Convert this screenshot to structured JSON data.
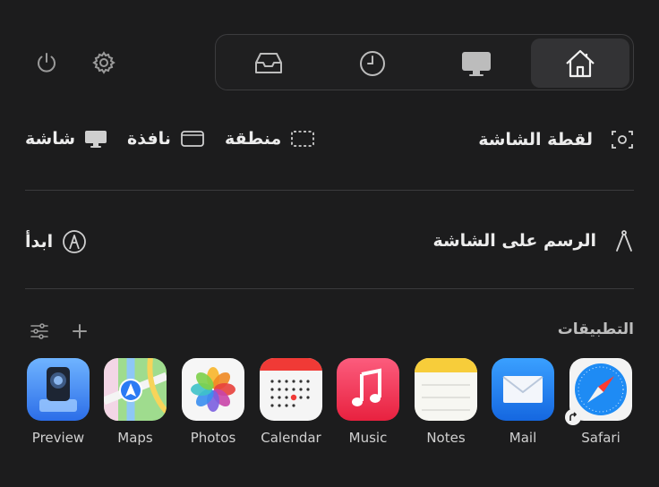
{
  "colors": {
    "background": "#1c1c1d",
    "active_segment": "#333335",
    "divider": "#3a3a3c"
  },
  "top_bar": {
    "left_icons": [
      "power-icon",
      "gear-icon"
    ],
    "segments": [
      {
        "icon": "tray-icon",
        "active": false
      },
      {
        "icon": "clock-icon",
        "active": false
      },
      {
        "icon": "display-icon",
        "active": false
      },
      {
        "icon": "home-icon",
        "active": true
      }
    ]
  },
  "screenshot": {
    "title": "لقطة الشاشة",
    "options": [
      "منطقة",
      "نافذة",
      "شاشة"
    ]
  },
  "draw": {
    "title": "الرسم على الشاشة",
    "start": "ابدأ"
  },
  "apps": {
    "title": "التطبيقات",
    "items": [
      "Safari",
      "Mail",
      "Notes",
      "Music",
      "Calendar",
      "Photos",
      "Maps",
      "Preview"
    ]
  }
}
